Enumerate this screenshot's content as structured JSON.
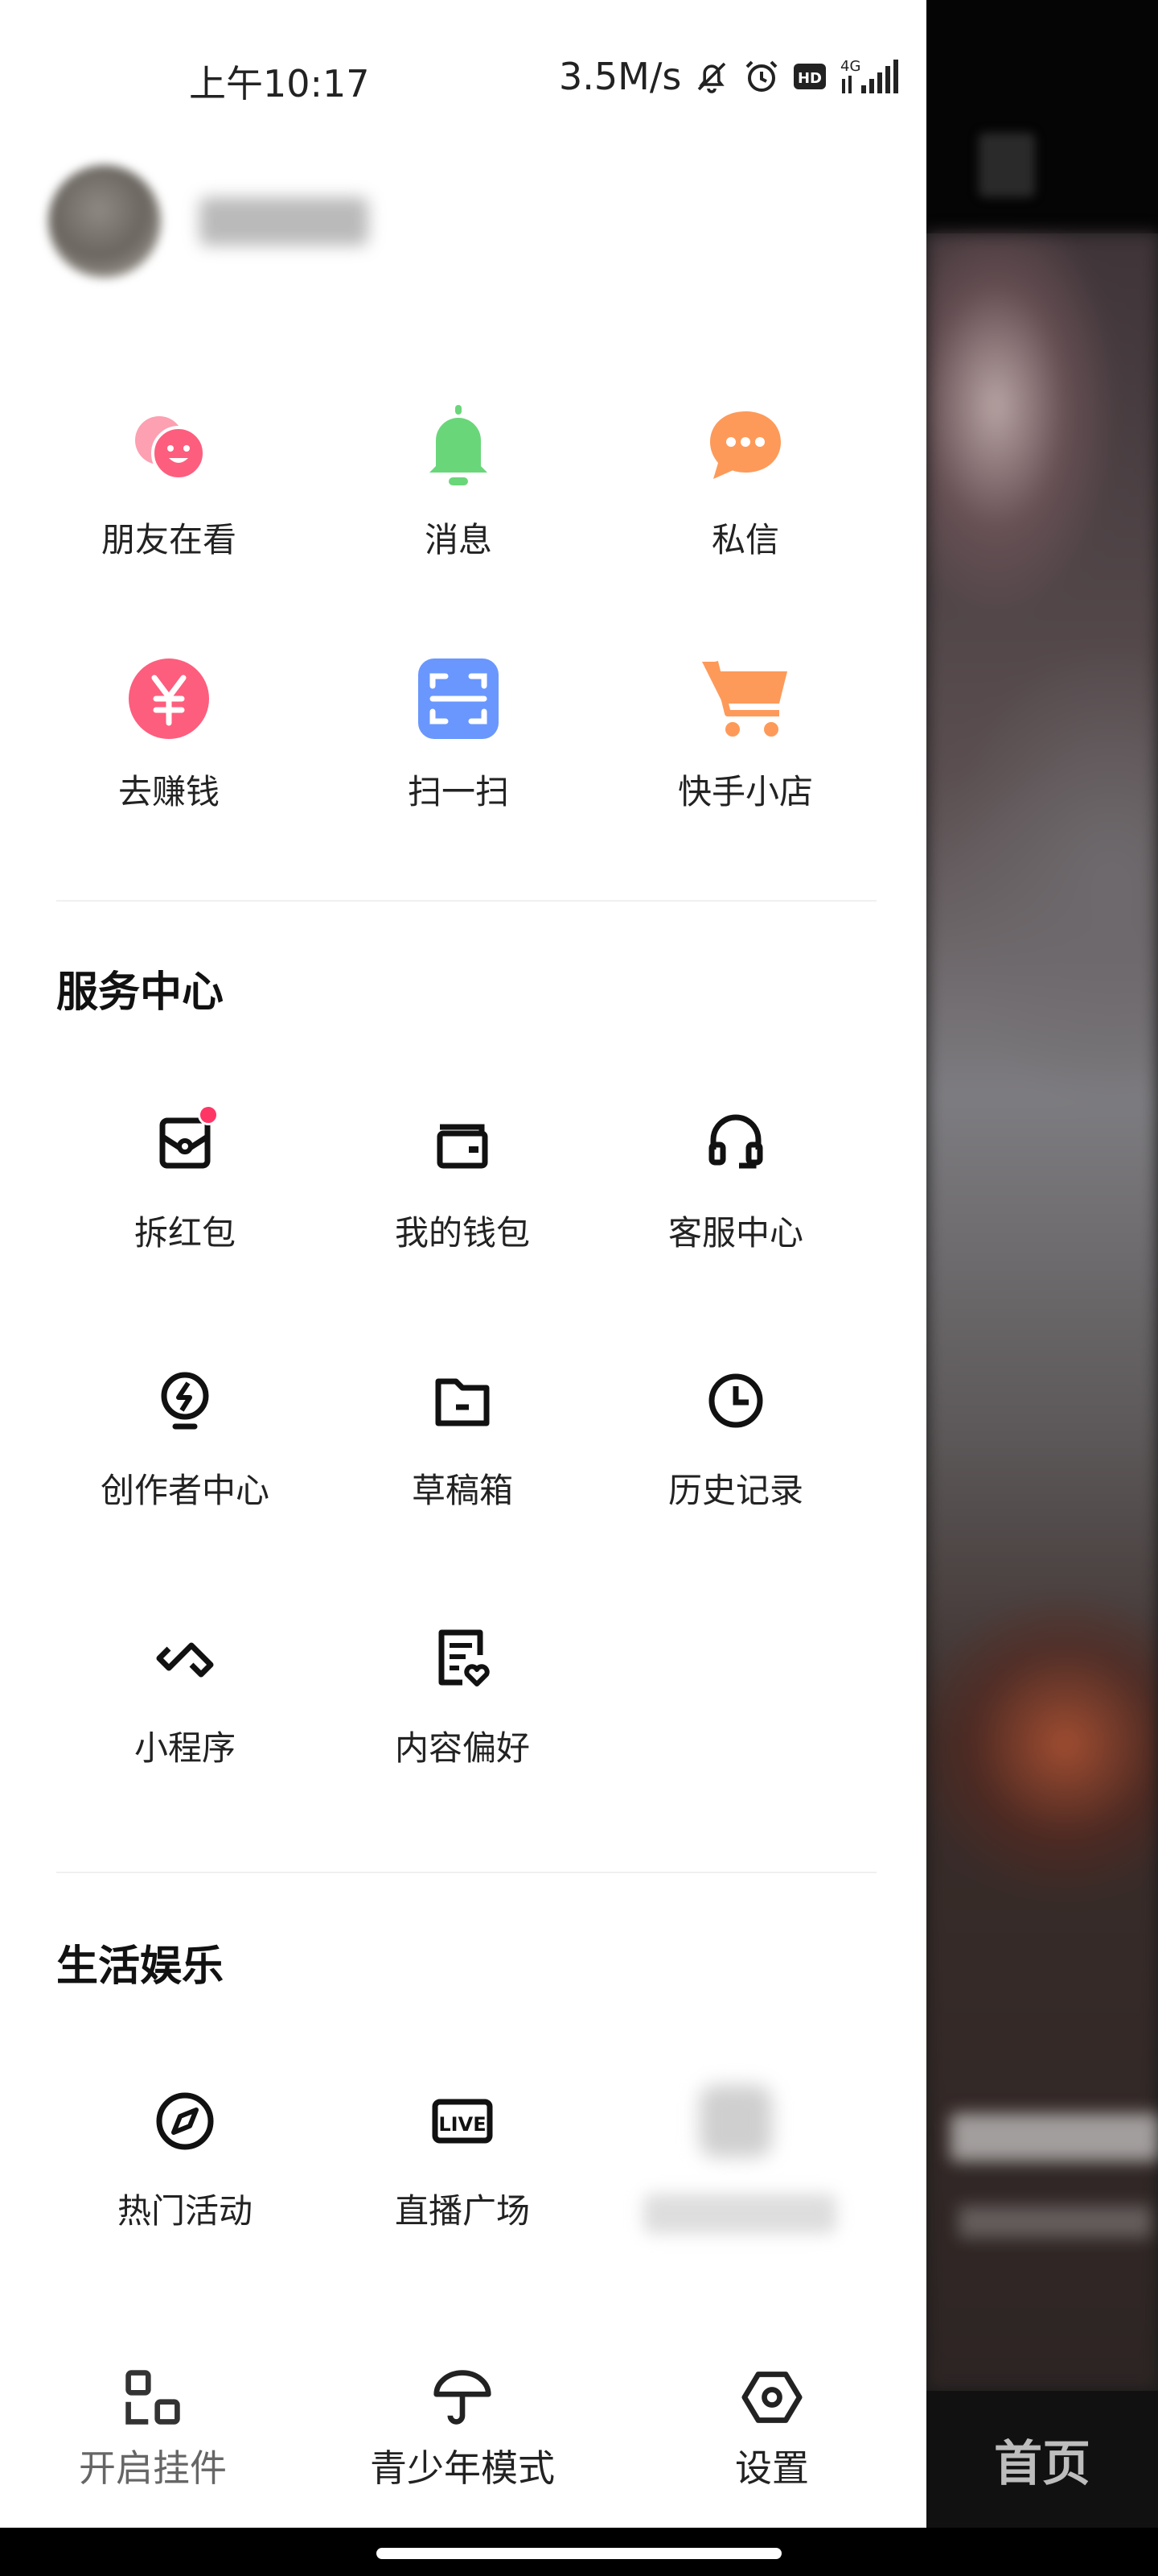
{
  "status_bar": {
    "time": "上午10:17",
    "network_speed": "3.5M/s",
    "hd_badge": "HD",
    "network_type": "4G"
  },
  "top_grid": [
    {
      "label": "朋友在看",
      "icon": "friends-watching-icon",
      "color": "#fd5e7e"
    },
    {
      "label": "消息",
      "icon": "bell-icon",
      "color": "#6ad67a"
    },
    {
      "label": "私信",
      "icon": "chat-bubble-icon",
      "color": "#fd9a5a"
    },
    {
      "label": "去赚钱",
      "icon": "yuan-coin-icon",
      "color": "#fd5e7e"
    },
    {
      "label": "扫一扫",
      "icon": "scan-icon",
      "color": "#6a97fd"
    },
    {
      "label": "快手小店",
      "icon": "shopping-cart-icon",
      "color": "#fd9a5a"
    }
  ],
  "service_center": {
    "title": "服务中心",
    "items": [
      {
        "label": "拆红包",
        "icon": "red-packet-icon",
        "has_badge": true
      },
      {
        "label": "我的钱包",
        "icon": "wallet-icon"
      },
      {
        "label": "客服中心",
        "icon": "headset-icon"
      },
      {
        "label": "创作者中心",
        "icon": "bulb-icon"
      },
      {
        "label": "草稿箱",
        "icon": "folder-icon"
      },
      {
        "label": "历史记录",
        "icon": "clock-icon"
      },
      {
        "label": "小程序",
        "icon": "infinity-icon"
      },
      {
        "label": "内容偏好",
        "icon": "document-heart-icon"
      }
    ]
  },
  "life_entertainment": {
    "title": "生活娱乐",
    "items": [
      {
        "label": "热门活动",
        "icon": "compass-icon"
      },
      {
        "label": "直播广场",
        "icon": "live-icon",
        "icon_text": "LIVE"
      }
    ]
  },
  "bottom_bar": {
    "items": [
      {
        "label": "开启挂件",
        "icon": "widget-icon"
      },
      {
        "label": "青少年模式",
        "icon": "umbrella-icon"
      },
      {
        "label": "设置",
        "icon": "settings-icon"
      }
    ]
  },
  "video_panel": {
    "nav_label": "首页"
  }
}
